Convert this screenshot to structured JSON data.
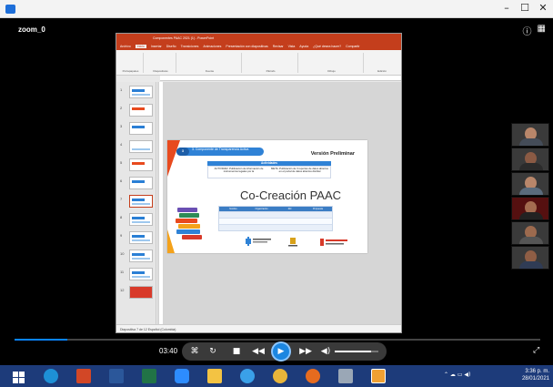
{
  "window": {
    "title": "",
    "min_glyph": "–",
    "max_glyph": "☐",
    "close_glyph": "✕"
  },
  "zoom": {
    "label": "zoom_0",
    "icons": [
      "info-icon",
      "grid-view-icon"
    ]
  },
  "ppt": {
    "title_text": "Componentes PAAC 2021 (1) - PowerPoint",
    "menu": [
      "Archivo",
      "Inicio",
      "Insertar",
      "Diseño",
      "Transiciones",
      "Animaciones",
      "Presentación con diapositivas",
      "Revisar",
      "Vista",
      "Ayuda",
      "¿Qué desea hacer?",
      "Compartir"
    ],
    "ribbon_groups": [
      "Portapapeles",
      "Diapositivas",
      "Fuente",
      "Párrafo",
      "Dibujo",
      "Edición"
    ],
    "status": "Diapositiva 7 de 12    Español (Colombia)",
    "slide_numbers": [
      "1",
      "2",
      "3",
      "4",
      "5",
      "6",
      "7",
      "8",
      "9",
      "10",
      "11",
      "12"
    ],
    "slide": {
      "component_num": "3",
      "component_text": "3. Componente de Transparencia Activa",
      "version": "Versión Preliminar",
      "activities_header": "Actividades",
      "activity_1": "ACTIVIDAD: Publicación de información de instrumentos legales por la",
      "activity_2": "META: Publicación de 3 reportes de datos abiertos en el portal de datos abiertos distrital",
      "heading": "Co-Creación PAAC",
      "grid_headers": [
        "Nombre",
        "Organización",
        "Rol",
        "Propuesta"
      ]
    }
  },
  "player": {
    "time": "03:40",
    "buttons": [
      "captions-icon",
      "repeat-icon",
      "stop-icon",
      "rewind-icon",
      "play-icon",
      "fast-forward-icon",
      "volume-icon"
    ],
    "progress": 0.1,
    "volume": 0.83
  },
  "taskbar": {
    "apps": [
      "start-icon",
      "edge-icon",
      "powerpoint-icon",
      "word-icon",
      "excel-icon",
      "zoom-icon",
      "files-icon",
      "edge-legacy-icon",
      "chrome-icon",
      "firefox-icon",
      "app-icon",
      "media-player-icon"
    ],
    "time": "3:36 p. m.",
    "date": "28/01/2021"
  }
}
